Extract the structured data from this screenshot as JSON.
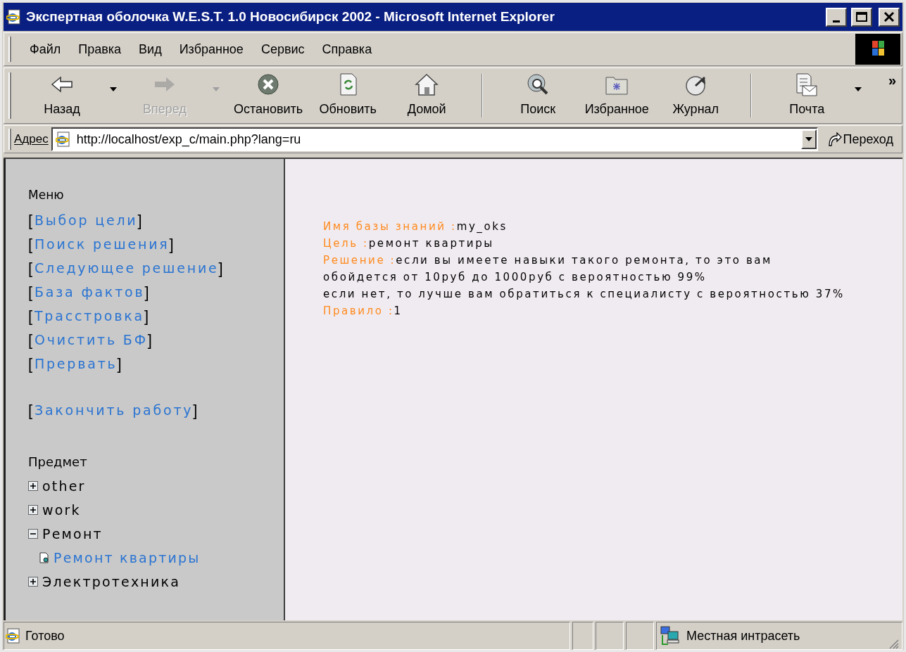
{
  "window": {
    "title": "Экспертная оболочка W.E.S.T. 1.0 Новосибирск 2002 - Microsoft Internet Explorer"
  },
  "menu_bar": [
    {
      "label": "Файл"
    },
    {
      "label": "Правка"
    },
    {
      "label": "Вид"
    },
    {
      "label": "Избранное"
    },
    {
      "label": "Сервис"
    },
    {
      "label": "Справка"
    }
  ],
  "toolbar": [
    {
      "kind": "back",
      "label": "Назад",
      "disabled": false,
      "dropdown": true
    },
    {
      "kind": "forward",
      "label": "Вперед",
      "disabled": true,
      "dropdown": true
    },
    {
      "kind": "stop",
      "label": "Остановить",
      "disabled": false,
      "dropdown": false
    },
    {
      "kind": "refresh",
      "label": "Обновить",
      "disabled": false,
      "dropdown": false
    },
    {
      "kind": "home",
      "label": "Домой",
      "disabled": false,
      "dropdown": false
    },
    {
      "kind": "separator"
    },
    {
      "kind": "search",
      "label": "Поиск",
      "disabled": false,
      "dropdown": false
    },
    {
      "kind": "favorites",
      "label": "Избранное",
      "disabled": false,
      "dropdown": false
    },
    {
      "kind": "history",
      "label": "Журнал",
      "disabled": false,
      "dropdown": false
    },
    {
      "kind": "separator"
    },
    {
      "kind": "mail",
      "label": "Почта",
      "disabled": false,
      "dropdown": true
    }
  ],
  "toolbar_overflow": "»",
  "address_bar": {
    "label": "Адрес",
    "value": "http://localhost/exp_c/main.php?lang=ru",
    "go_label": "Переход"
  },
  "sidebar": {
    "menu_title": "Меню",
    "menu_groups": [
      [
        {
          "open": "[",
          "label": "Выбор цели",
          "close": "]"
        },
        {
          "open": "[",
          "label": "Поиск решения",
          "close": "]"
        },
        {
          "open": "[",
          "label": "Следующее решение",
          "close": "]"
        },
        {
          "open": "[",
          "label": "База фактов",
          "close": "]"
        },
        {
          "open": "[",
          "label": "Трасстровка",
          "close": "]"
        },
        {
          "open": "[",
          "label": "Очистить БФ",
          "close": "]"
        },
        {
          "open": "[",
          "label": "Прервать",
          "close": "]"
        }
      ],
      [
        {
          "open": "[",
          "label": "Закончить работу",
          "close": "]"
        }
      ]
    ],
    "tree_title": "Предмет",
    "tree": [
      {
        "label": "other",
        "expanded": false
      },
      {
        "label": "work",
        "expanded": false
      },
      {
        "label": "Ремонт",
        "expanded": true,
        "children": [
          {
            "label": "Ремонт квартиры"
          }
        ]
      },
      {
        "label": "Электротехника",
        "expanded": false
      }
    ]
  },
  "content": {
    "fields": [
      {
        "label": "Имя базы знаний :",
        "value": [
          "my_oks"
        ]
      },
      {
        "label": "Цель :",
        "value": [
          "ремонт квартиры"
        ]
      },
      {
        "label": "Решение :",
        "value": [
          "если вы имеете навыки такого ремонта, то это вам",
          "обойдется от 10руб до 1000руб с вероятностью 99%",
          "если нет, то лучше вам обратиться к специалисту с вероятностью 37%"
        ]
      },
      {
        "label": "Правило :",
        "value": [
          "1"
        ]
      }
    ]
  },
  "status_bar": {
    "text": "Готово",
    "zone": "Местная интрасеть"
  }
}
